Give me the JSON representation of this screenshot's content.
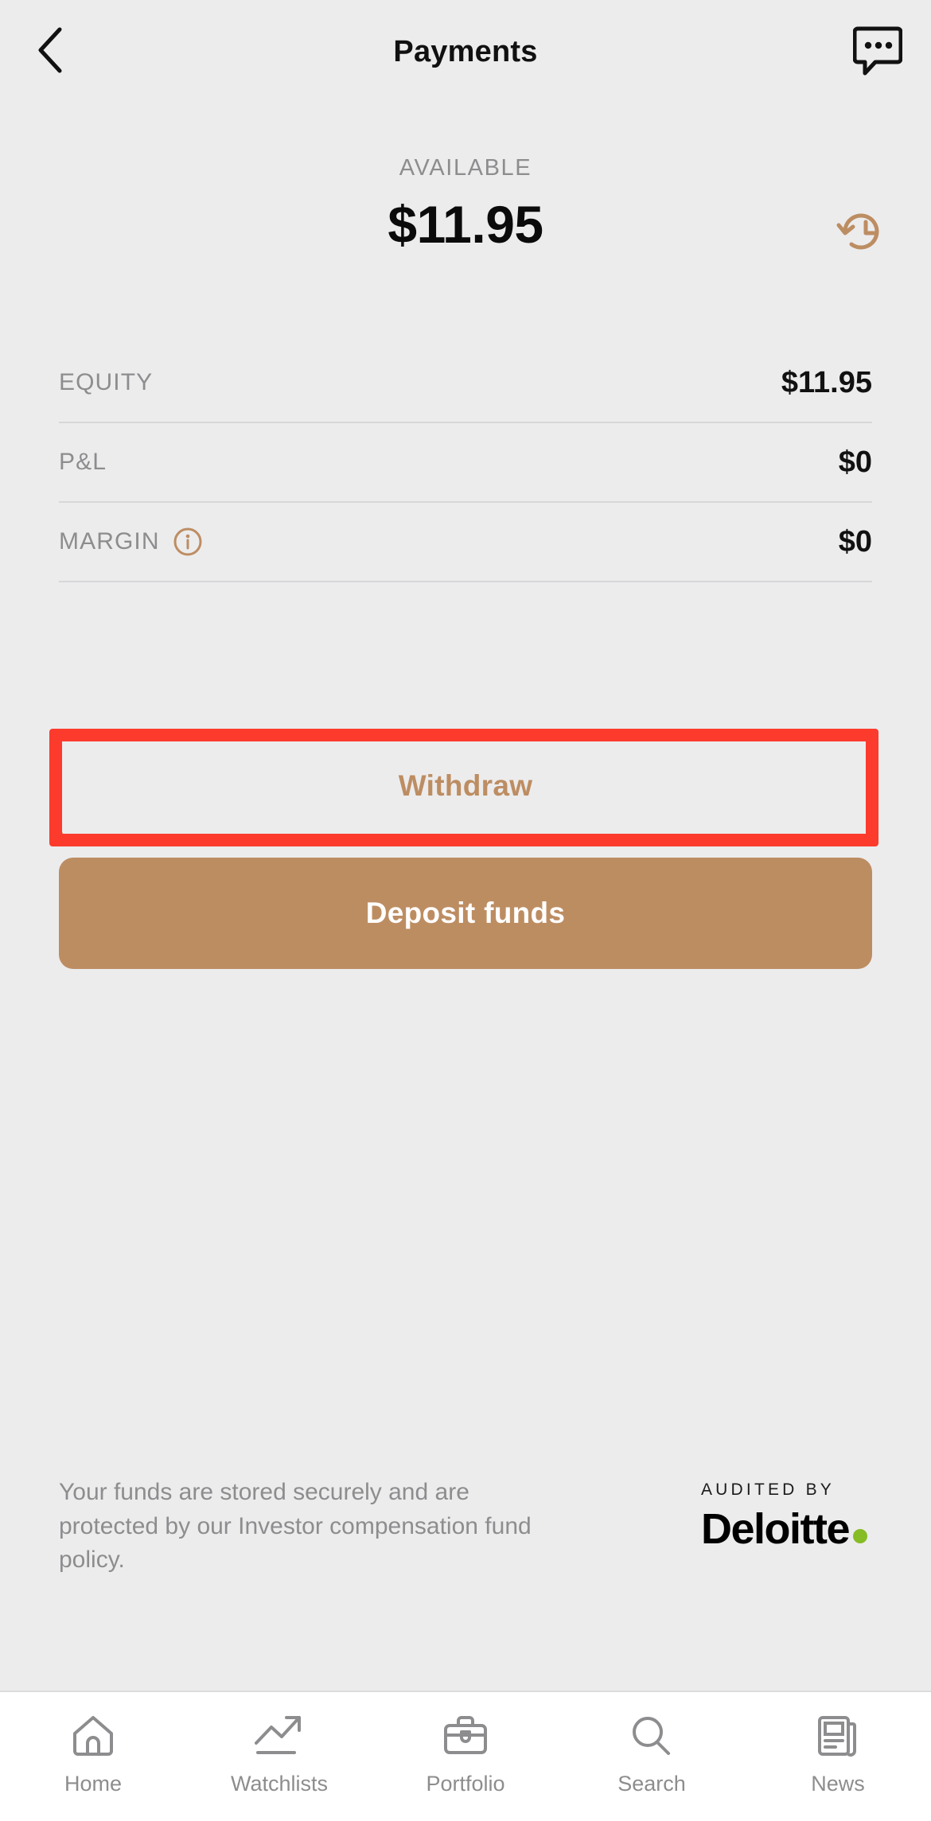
{
  "header": {
    "title": "Payments",
    "back_icon": "chevron-left-icon",
    "chat_icon": "chat-bubble-dots-icon"
  },
  "balance": {
    "label": "AVAILABLE",
    "amount": "$11.95",
    "history_icon": "history-clock-icon"
  },
  "stats": [
    {
      "label": "EQUITY",
      "value": "$11.95",
      "info": false
    },
    {
      "label": "P&L",
      "value": "$0",
      "info": false
    },
    {
      "label": "MARGIN",
      "value": "$0",
      "info": true,
      "info_icon": "info-circle-icon"
    }
  ],
  "actions": {
    "withdraw_label": "Withdraw",
    "deposit_label": "Deposit funds"
  },
  "annotation": {
    "target": "withdraw-button",
    "color": "#fc3b2d"
  },
  "footer": {
    "disclaimer": "Your funds are stored securely and are protected by our Investor compensation fund policy.",
    "audited_by": "AUDITED BY",
    "auditor": "Deloitte"
  },
  "bottom_nav": [
    {
      "label": "Home",
      "icon": "home-icon"
    },
    {
      "label": "Watchlists",
      "icon": "trending-up-icon"
    },
    {
      "label": "Portfolio",
      "icon": "briefcase-icon"
    },
    {
      "label": "Search",
      "icon": "magnifier-icon"
    },
    {
      "label": "News",
      "icon": "newspaper-icon"
    }
  ],
  "colors": {
    "accent": "#bd8d62",
    "background": "#ececed",
    "muted_text": "#8d8d8f",
    "annotation": "#fc3b2d",
    "deloitte_green": "#86bc24"
  }
}
